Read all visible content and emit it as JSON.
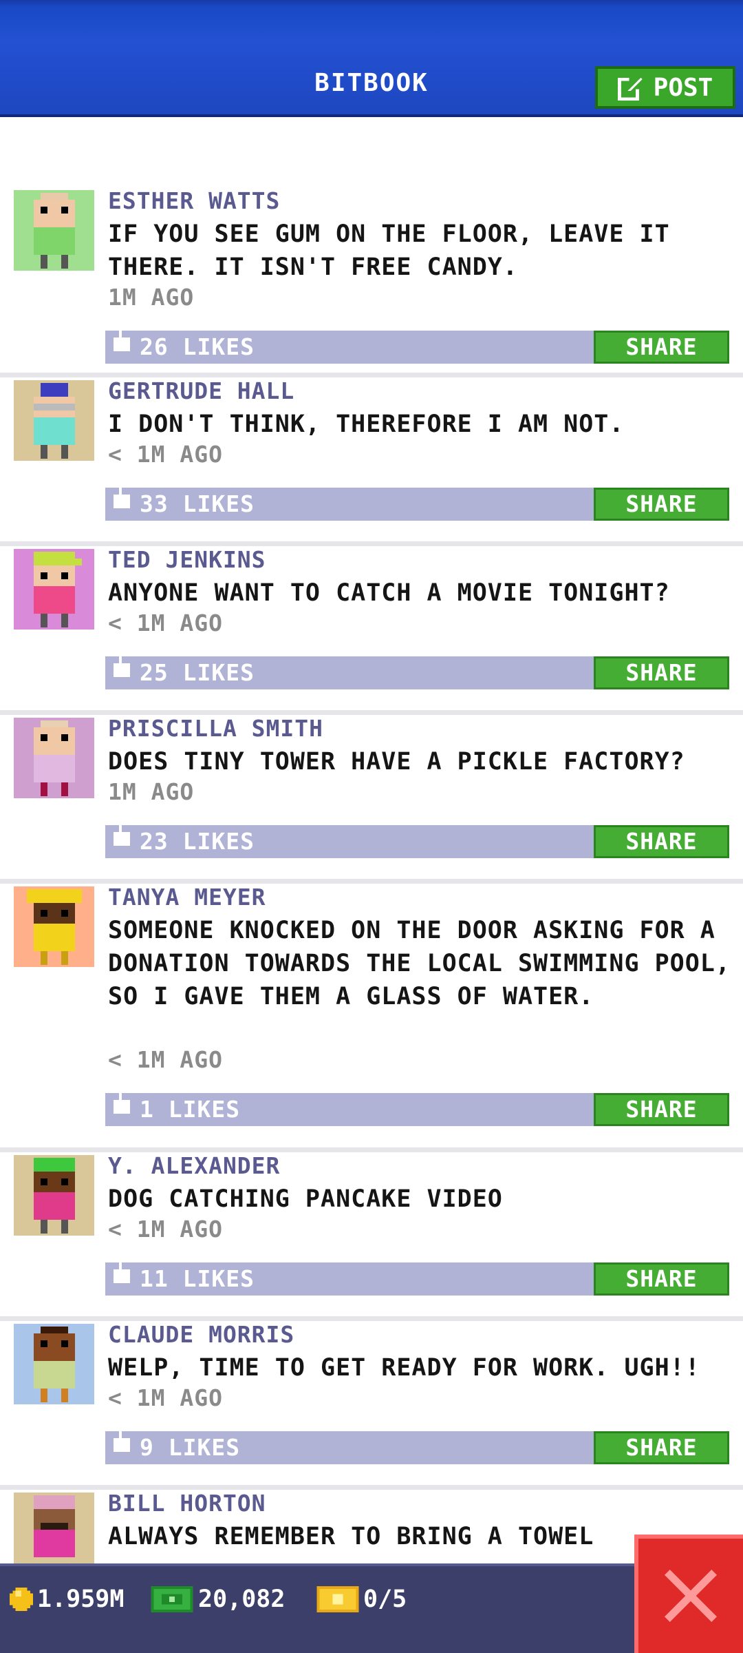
{
  "header": {
    "title": "BITBOOK",
    "post_label": "POST"
  },
  "posts": [
    {
      "author": "ESTHER WATTS",
      "message": "IF YOU SEE GUM ON THE FLOOR, LEAVE IT THERE. IT ISN'T FREE CANDY.",
      "time": "1M AGO",
      "likes": "26 LIKES",
      "share": "SHARE",
      "avatar_bg": "#9fdf8f"
    },
    {
      "author": "GERTRUDE HALL",
      "message": "I DON'T THINK, THEREFORE I AM NOT.",
      "time": "< 1M AGO",
      "likes": "33 LIKES",
      "share": "SHARE",
      "avatar_bg": "#d9c79a"
    },
    {
      "author": "TED JENKINS",
      "message": "ANYONE WANT TO CATCH A MOVIE TONIGHT?",
      "time": "< 1M AGO",
      "likes": "25 LIKES",
      "share": "SHARE",
      "avatar_bg": "#d98ad9"
    },
    {
      "author": "PRISCILLA SMITH",
      "message": "DOES TINY TOWER HAVE A PICKLE FACTORY?",
      "time": "1M AGO",
      "likes": "23 LIKES",
      "share": "SHARE",
      "avatar_bg": "#cfa0cf"
    },
    {
      "author": "TANYA MEYER",
      "message": "SOMEONE KNOCKED ON THE DOOR ASKING FOR A DONATION TOWARDS THE LOCAL SWIMMING POOL, SO I GAVE THEM A GLASS OF WATER.",
      "time": "< 1M AGO",
      "likes": "1 LIKES",
      "share": "SHARE",
      "avatar_bg": "#ffb08a"
    },
    {
      "author": "Y. ALEXANDER",
      "message": "DOG CATCHING PANCAKE VIDEO",
      "time": "< 1M AGO",
      "likes": "11 LIKES",
      "share": "SHARE",
      "avatar_bg": "#d9c79a"
    },
    {
      "author": "CLAUDE MORRIS",
      "message": "WELP, TIME TO GET READY FOR WORK. UGH!!",
      "time": "< 1M AGO",
      "likes": "9 LIKES",
      "share": "SHARE",
      "avatar_bg": "#a9c6ea"
    },
    {
      "author": "BILL HORTON",
      "message": "ALWAYS REMEMBER TO BRING A TOWEL",
      "avatar_bg": "#d9c79a"
    }
  ],
  "status": {
    "coins": "1.959M",
    "bux": "20,082",
    "tickets": "0/5"
  },
  "colors": {
    "header_blue": "#1e47c0",
    "share_green": "#45ad33",
    "likes_bar": "#b1b3d6",
    "author": "#5a5a90"
  }
}
